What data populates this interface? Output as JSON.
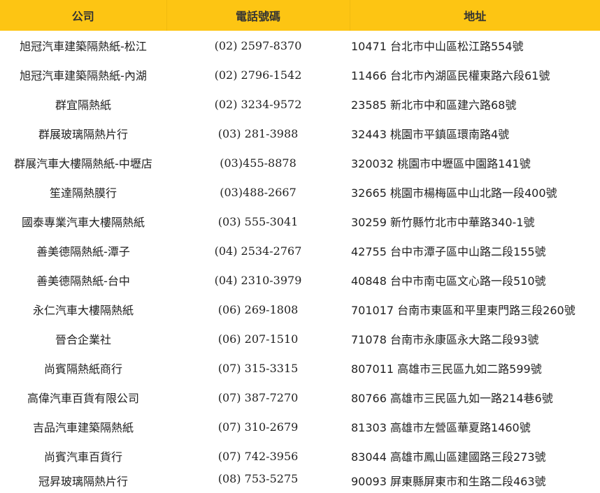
{
  "table": {
    "headers": {
      "company": "公司",
      "phone": "電話號碼",
      "address": "地址"
    },
    "rows": [
      {
        "company": "旭冠汽車建築隔熱紙-松江",
        "phone": "(02) 2597-8370",
        "address": "10471 台北市中山區松江路554號"
      },
      {
        "company": "旭冠汽車建築隔熱紙-內湖",
        "phone": "(02) 2796-1542",
        "address": "11466 台北市內湖區民權東路六段61號"
      },
      {
        "company": "群宜隔熱紙",
        "phone": "(02) 3234-9572",
        "address": "23585 新北市中和區建六路68號"
      },
      {
        "company": "群展玻璃隔熱片行",
        "phone": "(03) 281-3988",
        "address": "32443 桃園市平鎮區環南路4號"
      },
      {
        "company": "群展汽車大樓隔熱紙-中壢店",
        "phone": "(03)455-8878",
        "address": "320032 桃園市中壢區中園路141號"
      },
      {
        "company": "笙達隔熱膜行",
        "phone": "(03)488-2667",
        "address": "32665 桃園市楊梅區中山北路一段400號"
      },
      {
        "company": "國泰專業汽車大樓隔熱紙",
        "phone": "(03) 555-3041",
        "address": "30259 新竹縣竹北市中華路340-1號"
      },
      {
        "company": "善美德隔熱紙-潭子",
        "phone": "(04) 2534-2767",
        "address": "42755 台中市潭子區中山路二段155號"
      },
      {
        "company": "善美德隔熱紙-台中",
        "phone": "(04) 2310-3979",
        "address": "40848 台中市南屯區文心路一段510號"
      },
      {
        "company": "永仁汽車大樓隔熱紙",
        "phone": "(06) 269-1808",
        "address": "701017 台南市東區和平里東門路三段260號"
      },
      {
        "company": "晉合企業社",
        "phone": "(06) 207-1510",
        "address": "71078 台南市永康區永大路二段93號"
      },
      {
        "company": "尚賓隔熱紙商行",
        "phone": "(07) 315-3315",
        "address": "807011 高雄市三民區九如二路599號"
      },
      {
        "company": "高偉汽車百貨有限公司",
        "phone": "(07) 387-7270",
        "address": "80766 高雄市三民區九如一路214巷6號"
      },
      {
        "company": "吉品汽車建築隔熱紙",
        "phone": "(07) 310-2679",
        "address": "81303 高雄市左營區華夏路1460號"
      },
      {
        "company": "尚賓汽車百貨行",
        "phone": "(07) 742-3956",
        "address": "83044 高雄市鳳山區建國路三段273號"
      },
      {
        "company": "冠昇玻璃隔熱片行",
        "phone": "(08) 753-5275",
        "address": "90093 屏東縣屏東市和生路二段463號"
      }
    ]
  },
  "colors": {
    "header_background": "#fdc513"
  }
}
